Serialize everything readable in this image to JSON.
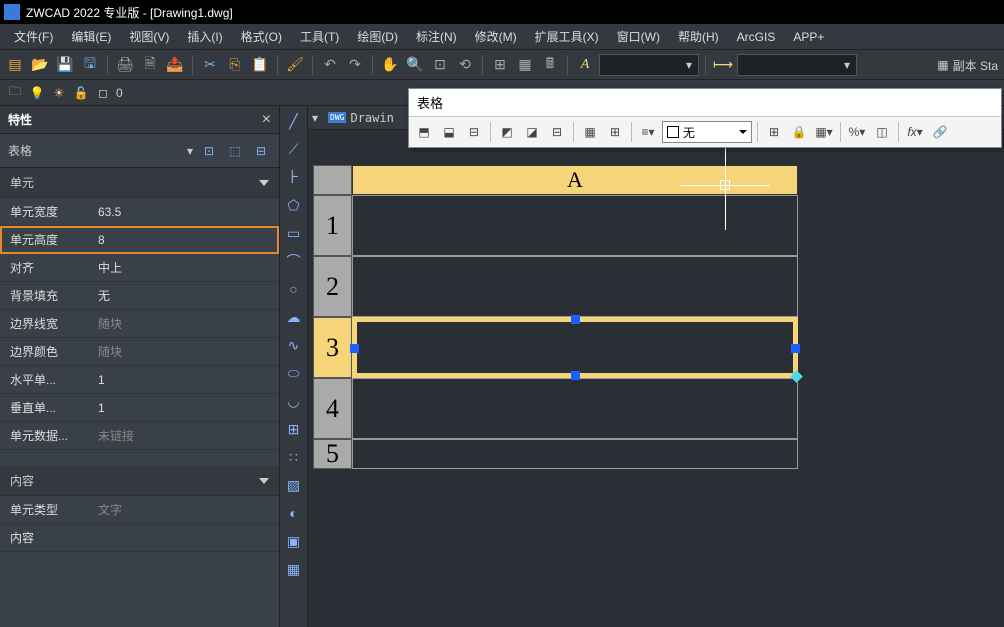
{
  "title": "ZWCAD 2022 专业版 - [Drawing1.dwg]",
  "menu": [
    "文件(F)",
    "编辑(E)",
    "视图(V)",
    "插入(I)",
    "格式(O)",
    "工具(T)",
    "绘图(D)",
    "标注(N)",
    "修改(M)",
    "扩展工具(X)",
    "窗口(W)",
    "帮助(H)",
    "ArcGIS",
    "APP+"
  ],
  "layerbar": {
    "layer_name": "0"
  },
  "floating_toolbar": {
    "title": "表格",
    "fill_combo": "无"
  },
  "far_right_text": "副本 Sta",
  "tab": {
    "name": "Drawin"
  },
  "props": {
    "title": "特性",
    "selector": "表格",
    "sections": {
      "unit": "单元",
      "content": "内容"
    },
    "rows": {
      "cell_width_label": "单元宽度",
      "cell_width_value": "63.5",
      "cell_height_label": "单元高度",
      "cell_height_value": "8",
      "align_label": "对齐",
      "align_value": "中上",
      "bg_label": "背景填充",
      "bg_value": "无",
      "border_w_label": "边界线宽",
      "border_w_value": "随块",
      "border_c_label": "边界颜色",
      "border_c_value": "随块",
      "h_unit_label": "水平单...",
      "h_unit_value": "1",
      "v_unit_label": "垂直单...",
      "v_unit_value": "1",
      "cell_data_label": "单元数据...",
      "cell_data_value": "未链接",
      "cell_type_label": "单元类型",
      "cell_type_value": "文字",
      "content_label": "内容",
      "content_value": ""
    }
  },
  "table": {
    "col_header": "A",
    "rows": [
      "1",
      "2",
      "3",
      "4",
      "5"
    ]
  }
}
